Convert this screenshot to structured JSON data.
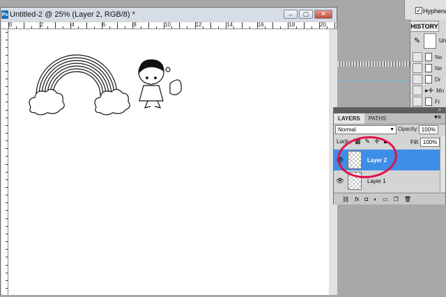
{
  "document": {
    "app_icon": "Ps",
    "title": "Untitled-2 @ 25% (Layer 2, RGB/8) *",
    "window_buttons": {
      "minimize": "–",
      "restore": "▢",
      "close": "✕"
    },
    "ruler_numbers": [
      "0",
      "2",
      "4",
      "6",
      "8",
      "10",
      "12",
      "14",
      "16",
      "18",
      "20"
    ]
  },
  "right_top": {
    "checkbox_label": "Hyphenat",
    "checkbox_mark": "✓"
  },
  "history": {
    "tab": "HISTORY",
    "snapshot_label": "Un",
    "rows": [
      "Ne",
      "Ne",
      "Dr",
      "Mo",
      "Fr"
    ]
  },
  "layers_panel": {
    "tabs": [
      "LAYERS",
      "PATHS"
    ],
    "blend_mode": "Normal",
    "opacity_label": "Opacity:",
    "opacity_value": "100%",
    "lock_label": "Lock:",
    "fill_label": "Fill:",
    "fill_value": "100%",
    "layers": [
      {
        "name": "Layer 2",
        "selected": true,
        "visible": true
      },
      {
        "name": "Layer 1",
        "selected": false,
        "visible": true
      }
    ],
    "bottom_icons": [
      "link-icon",
      "fx-icon",
      "mask-icon",
      "adjustment-icon",
      "group-icon",
      "new-layer-icon",
      "trash-icon"
    ]
  },
  "colors": {
    "selection": "#3d8ee6",
    "annotation": "#e0104a"
  }
}
